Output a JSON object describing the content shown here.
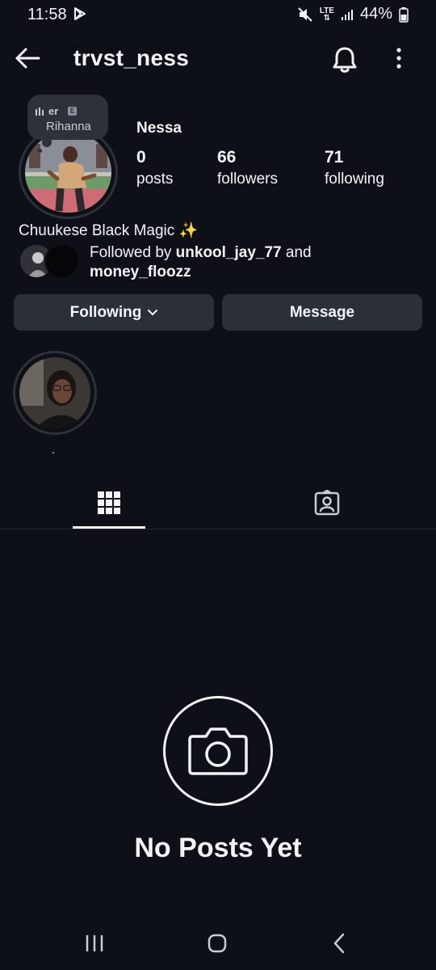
{
  "status_bar": {
    "time": "11:58",
    "lte": "LTE",
    "battery": "44%"
  },
  "header": {
    "username": "trvst_ness",
    "icons": [
      "back-arrow-icon",
      "bell-icon",
      "more-vert-icon"
    ]
  },
  "profile": {
    "display_name": "Nessa",
    "note": {
      "top_text": "er",
      "explicit_badge": "E",
      "song_artist": "Rihanna"
    },
    "stats": {
      "posts_count": "0",
      "posts_label": "posts",
      "followers_count": "66",
      "followers_label": "followers",
      "following_count": "71",
      "following_label": "following"
    },
    "bio": "Chuukese Black Magic ✨",
    "followed_by": {
      "prefix": "Followed by ",
      "user1": "unkool_jay_77",
      "joiner": " and",
      "user2": "money_floozz"
    }
  },
  "actions": {
    "following_label": "Following",
    "message_label": "Message"
  },
  "highlights": [
    {
      "label": "."
    }
  ],
  "tabs": {
    "active": "grid",
    "items": [
      "grid-icon",
      "tagged-icon"
    ]
  },
  "empty_state": {
    "title": "No Posts Yet"
  },
  "colors": {
    "background": "#0d1117",
    "button": "#2b2f36",
    "text": "#f2f4f7"
  }
}
